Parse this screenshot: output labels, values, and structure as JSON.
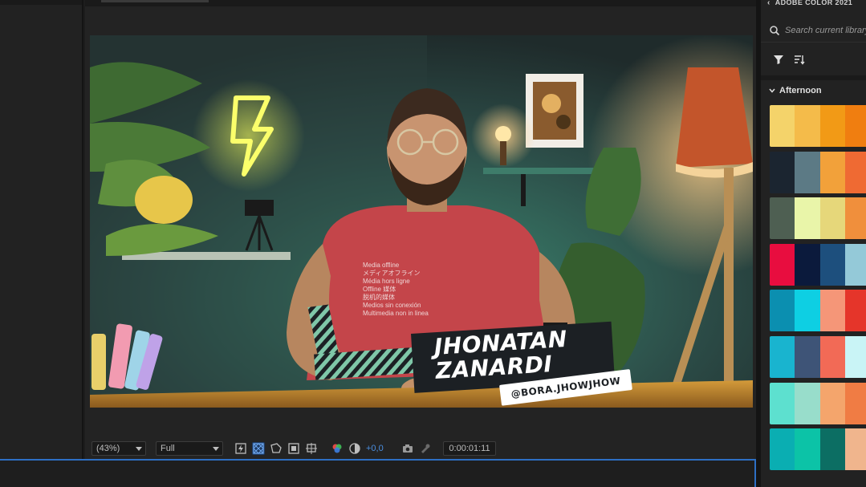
{
  "viewer": {
    "zoom": "(43%)",
    "resolution": "Full",
    "exposure": "+0,0",
    "timecode": "0:00:01:11"
  },
  "lower_third": {
    "name_line1": "JHONATAN",
    "name_line2": "ZANARDI",
    "handle": "@BORA.JHOWJHOW"
  },
  "shirt_text": [
    "Media offline",
    "メディアオフライン",
    "Média hors ligne",
    "Offline 媒体",
    "脱机的媒体",
    "Medios sin conexión",
    "Multimedia non in linea"
  ],
  "library_panel": {
    "title": "ADOBE COLOR 2021",
    "search_placeholder": "Search current library",
    "group": "Afternoon",
    "themes": [
      [
        "#f4d36a",
        "#f4bb4a",
        "#f29a16",
        "#f07e10"
      ],
      [
        "#1b2530",
        "#5c7a85",
        "#f2a13a",
        "#ef6a33"
      ],
      [
        "#4e5f52",
        "#e9f5a9",
        "#e6d77a",
        "#f08f3c"
      ],
      [
        "#e80d3f",
        "#0b1a3c",
        "#1d4f7d",
        "#94c9d8"
      ],
      [
        "#0b8fb0",
        "#0ecfe3",
        "#f59678",
        "#e5352a"
      ],
      [
        "#19b4cf",
        "#3e5477",
        "#f26a56",
        "#c9f4f6"
      ],
      [
        "#5de0cf",
        "#98ddcb",
        "#f4a56c",
        "#f07c44"
      ],
      [
        "#0aaeb2",
        "#0cc3a7",
        "#0c6e63",
        "#f0b58d"
      ]
    ]
  },
  "icons": {
    "zoom_caret": "chevron-down-icon",
    "lightning": "snapshot-icon",
    "transparency": "transparency-grid-icon",
    "mask": "mask-icon",
    "region": "region-of-interest-icon",
    "guides": "guides-icon",
    "channels": "color-channels-icon",
    "reset_exposure": "reset-exposure-icon",
    "camera": "camera-icon",
    "show_snapshot": "show-snapshot-icon",
    "search": "search-icon",
    "filter": "filter-icon",
    "sort": "sort-icon",
    "back": "chevron-left-icon",
    "group_chevron": "chevron-down-icon"
  }
}
